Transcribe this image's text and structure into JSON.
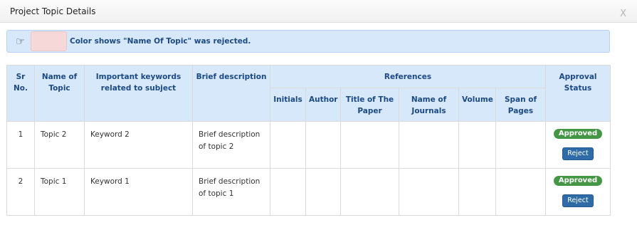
{
  "dialog": {
    "title": "Project Topic Details",
    "close_label": "X"
  },
  "legend": {
    "icon": "pointing-hand-icon",
    "swatch_color": "#f6d8d8",
    "text": "Color shows \"Name Of Topic\" was rejected."
  },
  "table": {
    "headers": {
      "sr_no": "Sr No.",
      "name_of_topic": "Name of Topic",
      "keywords": "Important keywords related to subject",
      "brief": "Brief description",
      "references": "References",
      "approval_status": "Approval Status"
    },
    "ref_headers": [
      "Initials",
      "Author",
      "Title of The Paper",
      "Name of Journals",
      "Volume",
      "Span of Pages"
    ],
    "rows": [
      {
        "sr": "1",
        "topic": "Topic 2",
        "keywords": "Keyword 2",
        "brief": "Brief description of topic 2",
        "refs": [
          "",
          "",
          "",
          "",
          "",
          ""
        ],
        "status": "Approved",
        "action": "Reject"
      },
      {
        "sr": "2",
        "topic": "Topic 1",
        "keywords": "Keyword 1",
        "brief": "Brief description of topic 1",
        "refs": [
          "",
          "",
          "",
          "",
          "",
          ""
        ],
        "status": "Approved",
        "action": "Reject"
      }
    ]
  },
  "colors": {
    "header_bg": "#d8e8fb",
    "header_text": "#1b4a82",
    "approved_badge": "#449645",
    "reject_button": "#2f6ca7"
  }
}
